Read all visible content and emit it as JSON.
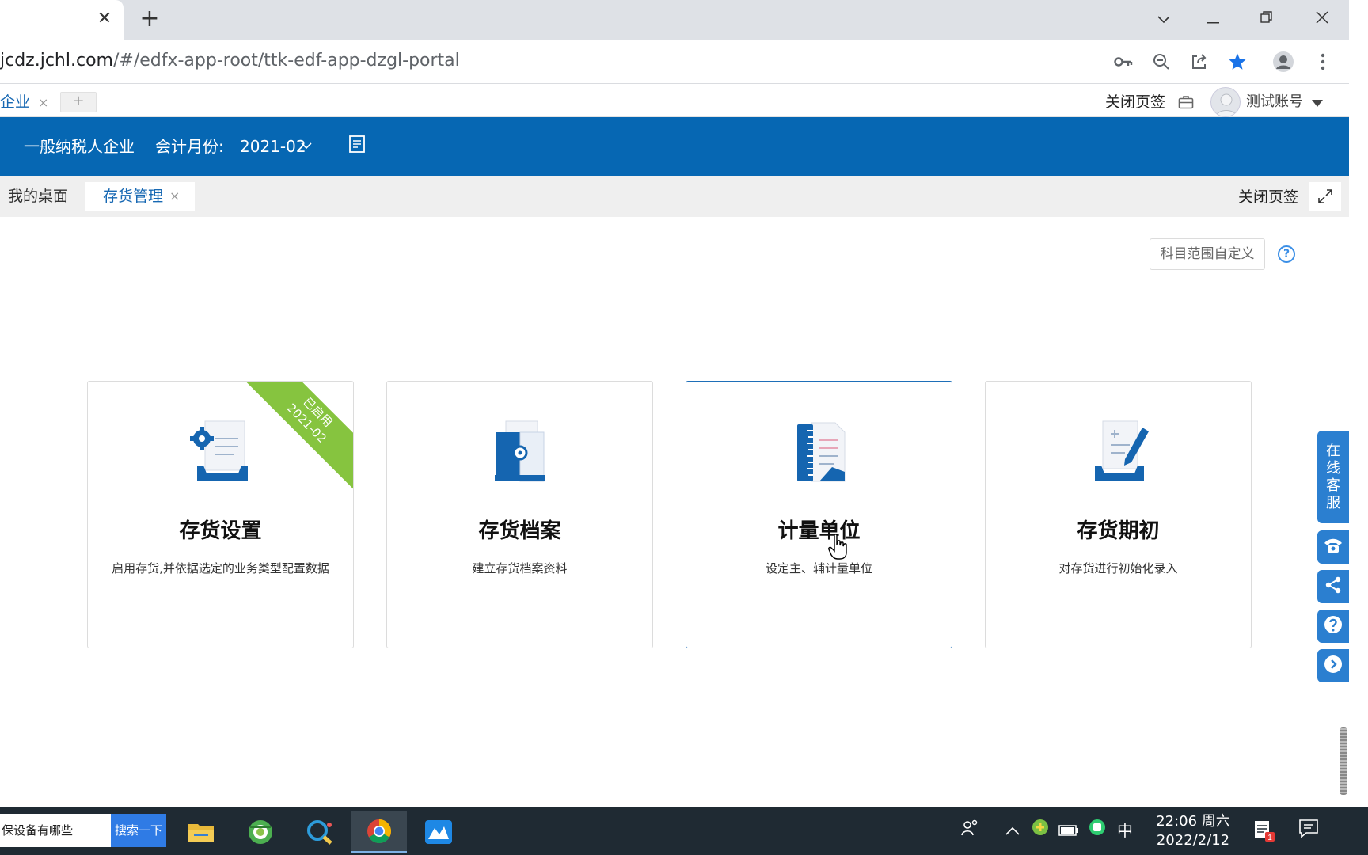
{
  "browser": {
    "url_host": "jcdz.jchl.com",
    "url_path": "/#/edfx-app-root/ttk-edf-app-dzgl-portal",
    "tab_close": "✕",
    "new_tab": "+"
  },
  "app_tabbar": {
    "enterprise_tab": "企业",
    "tab_close": "×",
    "add_tab": "+",
    "close_tabs": "关闭页签",
    "user_name": "测试账号"
  },
  "header": {
    "company_type": "一般纳税人企业",
    "month_label": "会计月份:",
    "month_value": "2021-02"
  },
  "page_tabs": {
    "desktop": "我的桌面",
    "inventory": "存货管理",
    "tab_close": "×",
    "close_tabs": "关闭页签"
  },
  "content": {
    "scope_button": "科目范围自定义",
    "help": "?"
  },
  "cards": [
    {
      "title": "存货设置",
      "desc": "启用存货,并依据选定的业务类型配置数据",
      "ribbon_line1": "已启用",
      "ribbon_line2": "2021-02"
    },
    {
      "title": "存货档案",
      "desc": "建立存货档案资料"
    },
    {
      "title": "计量单位",
      "desc": "设定主、辅计量单位"
    },
    {
      "title": "存货期初",
      "desc": "对存货进行初始化录入"
    }
  ],
  "float": {
    "service": [
      "在",
      "线",
      "客",
      "服"
    ]
  },
  "taskbar": {
    "search_text": "保设备有哪些",
    "search_button": "搜索一下",
    "ime": "中",
    "time": "22:06 周六",
    "date": "2022/2/12",
    "notification_badge": "1"
  }
}
